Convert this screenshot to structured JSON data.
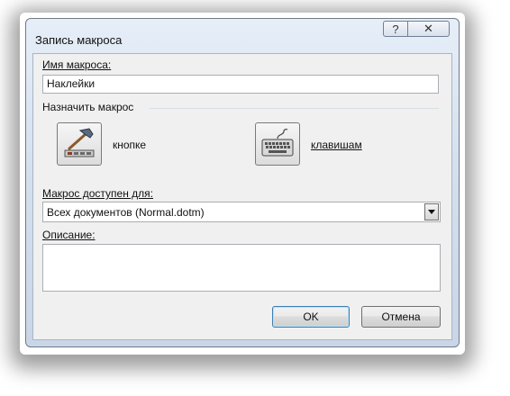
{
  "dialog": {
    "title": "Запись макроса",
    "help_glyph": "?",
    "close_glyph": "✕"
  },
  "macro_name": {
    "label": "Имя макроса:",
    "value": "Наклейки"
  },
  "assign": {
    "group_label": "Назначить макрос",
    "button_label": "кнопке",
    "keyboard_label": "клавишам"
  },
  "available_for": {
    "label": "Макрос доступен для:",
    "value": "Всех документов (Normal.dotm)"
  },
  "description": {
    "label": "Описание:",
    "value": ""
  },
  "buttons": {
    "ok": "OK",
    "cancel": "Отмена"
  }
}
